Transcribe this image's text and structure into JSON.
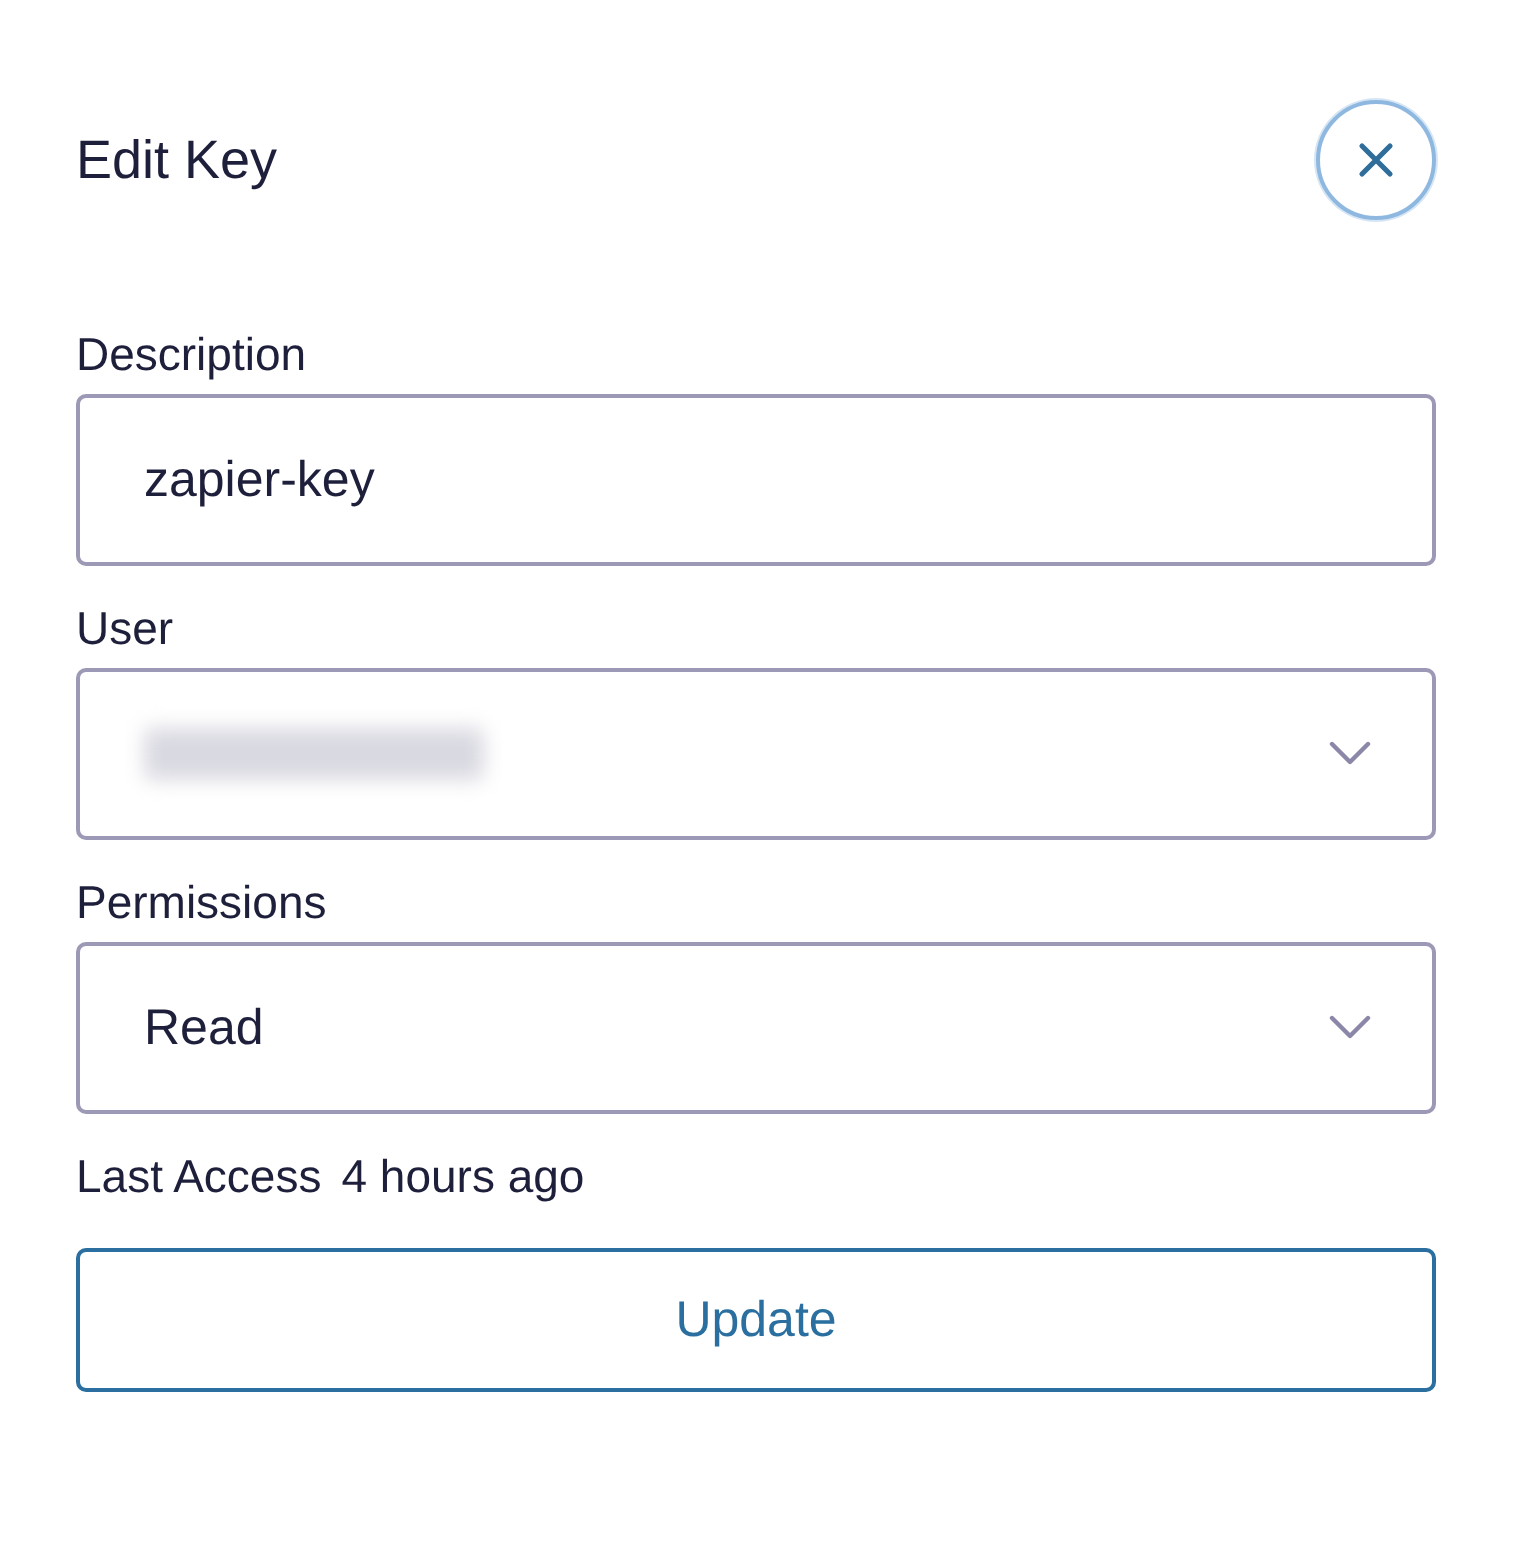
{
  "title": "Edit Key",
  "fields": [
    {
      "label": "Description",
      "kind": "text",
      "value": "zapier-key",
      "redacted": false
    },
    {
      "label": "User",
      "kind": "select",
      "redacted": true
    },
    {
      "label": "Permissions",
      "kind": "select",
      "value": "Read",
      "redacted": false
    }
  ],
  "last_access": {
    "label": "Last Access",
    "value": "4 hours ago"
  },
  "button": "Update"
}
